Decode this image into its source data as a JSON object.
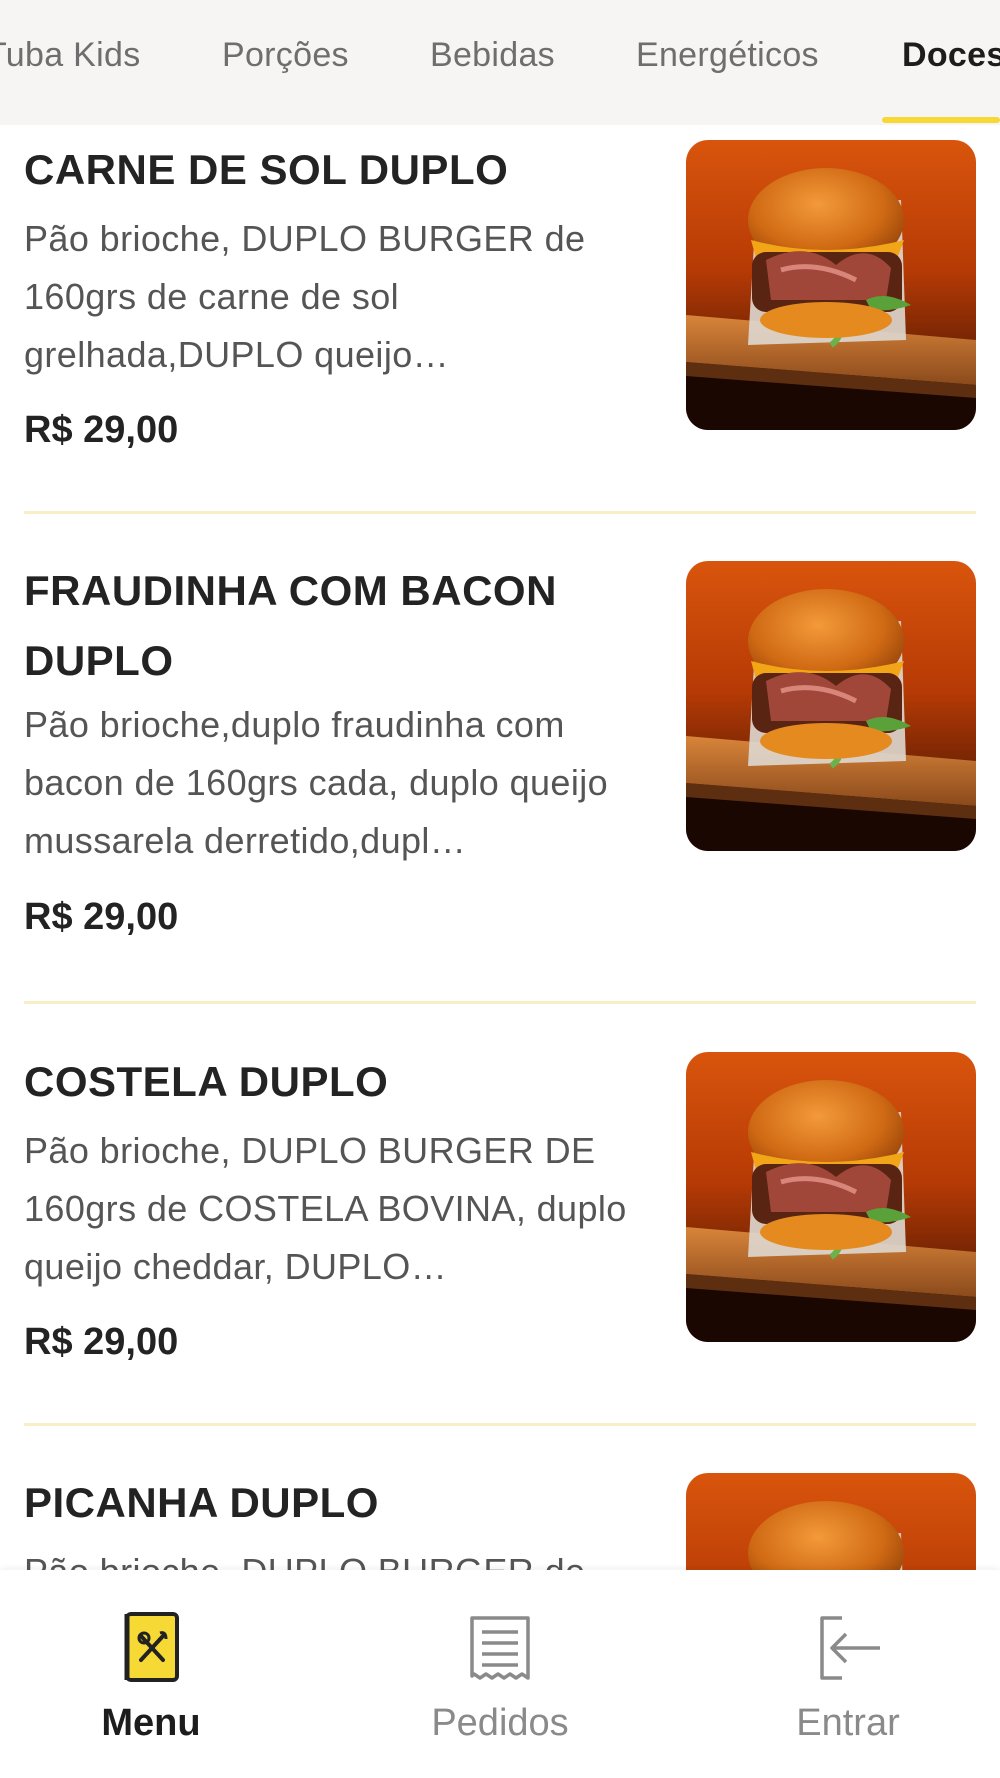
{
  "tabs": [
    {
      "label": "Tuba Kids"
    },
    {
      "label": "Porções"
    },
    {
      "label": "Bebidas"
    },
    {
      "label": "Energéticos"
    },
    {
      "label": "Doces"
    }
  ],
  "active_tab": "Doces",
  "colors": {
    "accent": "#f7d935",
    "divider": "#f8efc6",
    "tab_bar_bg": "#f6f5f3"
  },
  "products": [
    {
      "title": "CARNE DE SOL DUPLO",
      "description": "Pão brioche, DUPLO BURGER de 160grs de carne de sol grelhada,DUPLO queijo…",
      "price": "R$ 29,00",
      "image": "burger-photo"
    },
    {
      "title": "FRAUDINHA COM BACON DUPLO",
      "description": "Pão brioche,duplo fraudinha com bacon de 160grs cada, duplo queijo mussarela derretido,dupl…",
      "price": "R$ 29,00",
      "image": "burger-photo"
    },
    {
      "title": "COSTELA DUPLO",
      "description": "Pão brioche, DUPLO BURGER DE 160grs de COSTELA BOVINA, duplo queijo cheddar, DUPLO…",
      "price": "R$ 29,00",
      "image": "burger-photo"
    },
    {
      "title": "PICANHA DUPLO",
      "description": "Pão brioche, DUPLO BURGER de",
      "price": "",
      "image": "burger-photo"
    }
  ],
  "bottom_nav": [
    {
      "label": "Menu",
      "icon": "menu-book-icon"
    },
    {
      "label": "Pedidos",
      "icon": "receipt-icon"
    },
    {
      "label": "Entrar",
      "icon": "login-icon"
    }
  ],
  "active_nav": "Menu"
}
